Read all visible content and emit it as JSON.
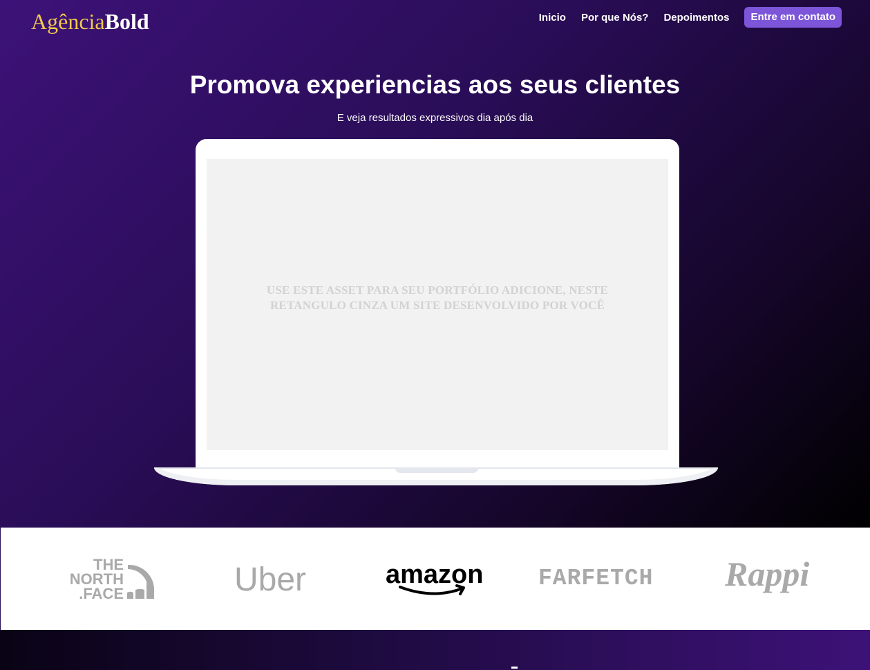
{
  "brand": {
    "part1": "Agência",
    "part2": "Bold"
  },
  "nav": {
    "items": [
      "Inicio",
      "Por que Nós?",
      "Depoimentos"
    ],
    "cta": "Entre em contato"
  },
  "hero": {
    "title": "Promova experiencias aos seus clientes",
    "subtitle": "E veja resultados expressivos dia após dia",
    "screen_placeholder_line1": "USE ESTE ASSET PARA SEU PORTFÓLIO ADICIONE, NESTE",
    "screen_placeholder_line2": "RETANGULO CINZA UM SITE DESENVOLVIDO POR VOCÊ"
  },
  "brands": {
    "northface": [
      "THE",
      "NORTH",
      ".FACE"
    ],
    "uber": "Uber",
    "amazon": "amazon",
    "farfetch": "FARFETCH",
    "rappi": "Rappi"
  },
  "colors": {
    "accent": "#7c55d8",
    "logo_gold": "#f2c94c",
    "hero_dark": "#000000",
    "hero_purple": "#3d1278"
  }
}
